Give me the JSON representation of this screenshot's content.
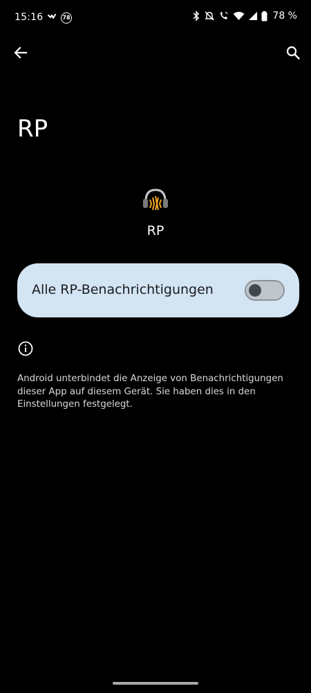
{
  "status_bar": {
    "time": "15:16",
    "badge_number": "78",
    "battery_percent": "78 %",
    "icons": [
      "heart-rate-icon",
      "badge-78-icon",
      "bluetooth-icon",
      "mute-icon",
      "wifi-calling-icon",
      "wifi-icon",
      "signal-icon",
      "battery-icon"
    ]
  },
  "top_bar": {
    "back_icon": "arrow-left-icon",
    "search_icon": "search-icon"
  },
  "page": {
    "title": "RP"
  },
  "app": {
    "icon": "headphones-icon",
    "name": "RP"
  },
  "notification_toggle": {
    "label": "Alle RP-Benachrichtigungen",
    "enabled": false
  },
  "info": {
    "icon": "info-icon",
    "text": "Android unterbindet die Anzeige von Benachrichtigungen dieser App auf diesem Gerät. Sie haben dies in den Einstellungen festgelegt."
  },
  "colors": {
    "background": "#000000",
    "card": "#d3e4f3",
    "accent_icon": "#f5a623"
  }
}
